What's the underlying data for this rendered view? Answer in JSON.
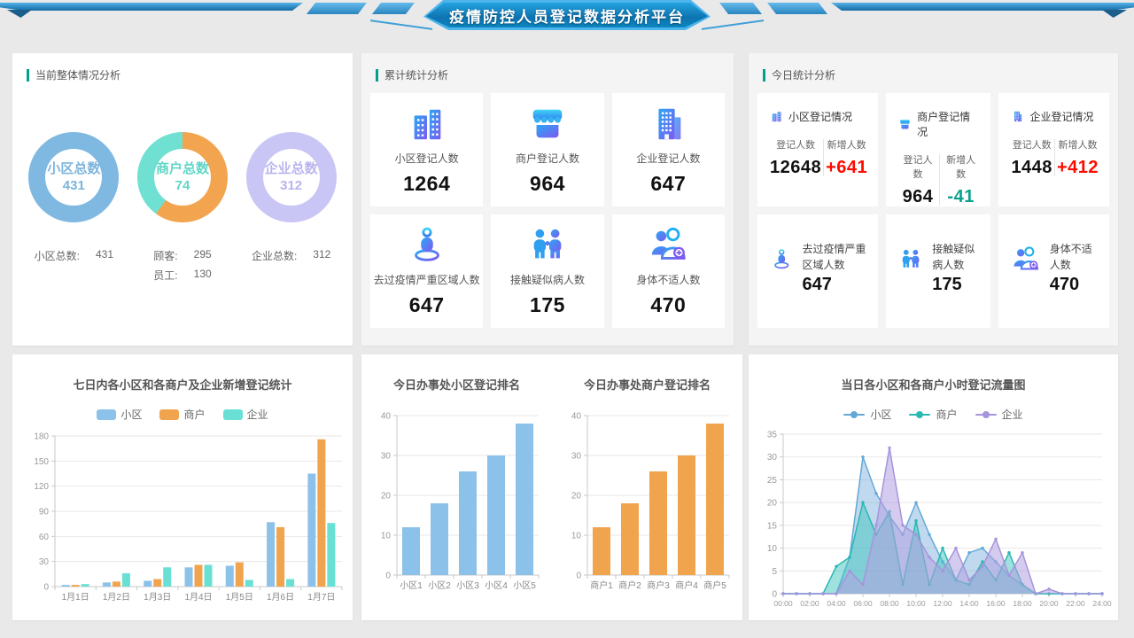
{
  "header": {
    "title": "疫情防控人员登记数据分析平台"
  },
  "panels": {
    "overall": {
      "title": "当前整体情况分析",
      "donuts": [
        {
          "label": "小区总数",
          "value": "431",
          "text_color": "#7db4dd",
          "segments": [
            {
              "color": "#7fb9e1",
              "pct": 100
            }
          ],
          "caption": [
            {
              "k": "小区总数:",
              "v": "431"
            }
          ]
        },
        {
          "label": "商户总数",
          "value": "74",
          "text_color": "#5fd6c6",
          "segments": [
            {
              "color": "#f2a44f",
              "pct": 60
            },
            {
              "color": "#6fe0d1",
              "pct": 40
            }
          ],
          "caption": [
            {
              "k": "顾客:",
              "v": "295"
            },
            {
              "k": "员工:",
              "v": "130"
            }
          ]
        },
        {
          "label": "企业总数",
          "value": "312",
          "text_color": "#b9b4ef",
          "segments": [
            {
              "color": "#c9c5f5",
              "pct": 100
            }
          ],
          "caption": [
            {
              "k": "企业总数:",
              "v": "312"
            }
          ]
        }
      ]
    },
    "cumulative": {
      "title": "累计统计分析",
      "cards": [
        {
          "icon": "building-icon",
          "label": "小区登记人数",
          "value": "1264"
        },
        {
          "icon": "shop-icon",
          "label": "商户登记人数",
          "value": "964"
        },
        {
          "icon": "office-icon",
          "label": "企业登记人数",
          "value": "647"
        },
        {
          "icon": "person-location-icon",
          "label": "去过疫情严重区域人数",
          "value": "647"
        },
        {
          "icon": "two-people-icon",
          "label": "接触疑似病人数",
          "value": "175"
        },
        {
          "icon": "people-plus-icon",
          "label": "身体不适人数",
          "value": "470"
        }
      ]
    },
    "today": {
      "title": "今日统计分析",
      "stat_cards": [
        {
          "icon": "building-icon",
          "title": "小区登记情况",
          "col1_label": "登记人数",
          "col1_value": "12648",
          "col2_label": "新增人数",
          "col2_value": "+641",
          "col2_color": "#fe0b00"
        },
        {
          "icon": "shop-icon",
          "title": "商户登记情况",
          "col1_label": "登记人数",
          "col1_value": "964",
          "col2_label": "新增人数",
          "col2_value": "-41",
          "col2_color": "#0ca18e"
        },
        {
          "icon": "office-icon",
          "title": "企业登记情况",
          "col1_label": "登记人数",
          "col1_value": "1448",
          "col2_label": "新增人数",
          "col2_value": "+412",
          "col2_color": "#fe0b00"
        }
      ],
      "info_cards": [
        {
          "icon": "person-location-icon",
          "label": "去过疫情严重区域人数",
          "value": "647"
        },
        {
          "icon": "two-people-icon",
          "label": "接触疑似病人数",
          "value": "175"
        },
        {
          "icon": "people-plus-icon",
          "label": "身体不适人数",
          "value": "470"
        }
      ]
    }
  },
  "chart_data": [
    {
      "type": "bar",
      "title": "七日内各小区和各商户及企业新增登记统计",
      "categories": [
        "1月1日",
        "1月2日",
        "1月3日",
        "1月4日",
        "1月5日",
        "1月6日",
        "1月7日"
      ],
      "series": [
        {
          "name": "小区",
          "color": "#8cc2e9",
          "values": [
            2,
            5,
            7,
            23,
            25,
            77,
            135
          ]
        },
        {
          "name": "商户",
          "color": "#f1a44e",
          "values": [
            2,
            6,
            9,
            26,
            29,
            71,
            176
          ]
        },
        {
          "name": "企业",
          "color": "#6ae0d4",
          "values": [
            3,
            16,
            23,
            26,
            8,
            9,
            76
          ]
        }
      ],
      "ylim": [
        0,
        180
      ],
      "ytick": 30,
      "grid": true,
      "legend_position": "top"
    },
    {
      "type": "bar",
      "title": "今日办事处小区登记排名",
      "categories": [
        "小区1",
        "小区2",
        "小区3",
        "小区4",
        "小区5"
      ],
      "values": [
        12,
        18,
        26,
        30,
        38
      ],
      "color": "#8cc2e9",
      "ylim": [
        0,
        40
      ],
      "ytick": 10,
      "grid": true
    },
    {
      "type": "bar",
      "title": "今日办事处商户登记排名",
      "categories": [
        "商户1",
        "商户2",
        "商户3",
        "商户4",
        "商户5"
      ],
      "values": [
        12,
        18,
        26,
        30,
        38
      ],
      "color": "#f1a44e",
      "ylim": [
        0,
        40
      ],
      "ytick": 10,
      "grid": true
    },
    {
      "type": "area",
      "title": "当日各小区和各商户小时登记流量图",
      "x_hours": [
        0,
        24
      ],
      "x_tick_labels": [
        "00:00",
        "02:00",
        "04:00",
        "06:00",
        "08:00",
        "10:00",
        "12:00",
        "14:00",
        "16:00",
        "18:00",
        "20:00",
        "22:00",
        "24:00"
      ],
      "series": [
        {
          "name": "小区",
          "color": "#64a8d8",
          "fill": "rgba(116,170,220,0.45)",
          "values": [
            0,
            0,
            0,
            0,
            0,
            8,
            30,
            22,
            17,
            13,
            20,
            13,
            7,
            3,
            9,
            10,
            7,
            4,
            2,
            0,
            0,
            0,
            0,
            0,
            0
          ]
        },
        {
          "name": "商户",
          "color": "#2ab8b2",
          "fill": "rgba(64,196,190,0.5)",
          "values": [
            0,
            0,
            0,
            0,
            6,
            8,
            20,
            13,
            18,
            2,
            16,
            2,
            10,
            3,
            2,
            7,
            3,
            9,
            2,
            0,
            0,
            0,
            0,
            0,
            0
          ]
        },
        {
          "name": "企业",
          "color": "#a694dc",
          "fill": "rgba(178,160,224,0.55)",
          "values": [
            0,
            0,
            0,
            0,
            0,
            5,
            2,
            15,
            32,
            15,
            13,
            8,
            5,
            10,
            3,
            6,
            12,
            4,
            9,
            0,
            1,
            0,
            0,
            0,
            0
          ]
        }
      ],
      "ylim": [
        0,
        35
      ],
      "ytick": 5,
      "grid": true,
      "legend_position": "top"
    }
  ]
}
